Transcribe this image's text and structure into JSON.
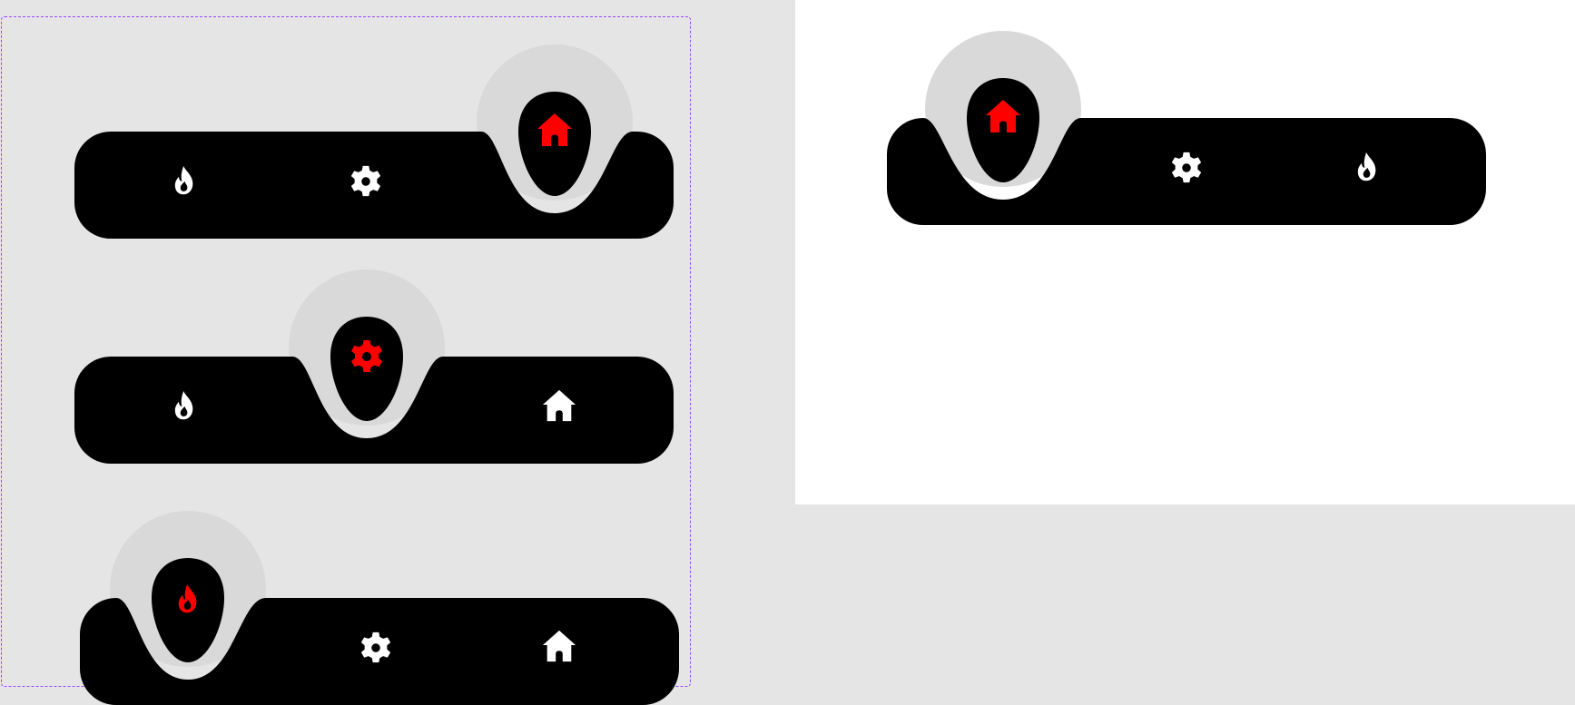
{
  "colors": {
    "canvas": "#e5e5e5",
    "frame_border": "#9747ff",
    "bar": "#000000",
    "bubble_halo": "#d9d9d9",
    "icon_default": "#ffffff",
    "icon_active": "#ff0000"
  },
  "variant_frame": {
    "variants": [
      {
        "name": "home-active",
        "active_icon": "home-icon",
        "inactive_icons": [
          "fire-icon",
          "gear-icon"
        ]
      },
      {
        "name": "settings-active",
        "active_icon": "gear-icon",
        "inactive_icons": [
          "fire-icon",
          "home-icon"
        ]
      },
      {
        "name": "fire-active",
        "active_icon": "fire-icon",
        "inactive_icons": [
          "gear-icon",
          "home-icon"
        ]
      }
    ]
  },
  "preview": {
    "active_icon": "home-icon",
    "inactive_icons": [
      "gear-icon",
      "fire-icon"
    ]
  }
}
